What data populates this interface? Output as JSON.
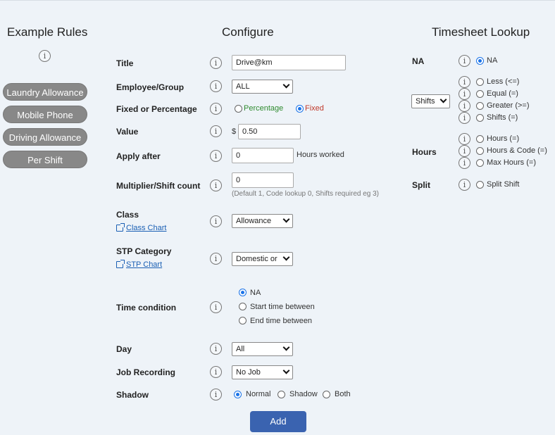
{
  "headings": {
    "example_rules": "Example Rules",
    "configure": "Configure",
    "timesheet_lookup": "Timesheet Lookup"
  },
  "example_rules": [
    "Laundry Allowance",
    "Mobile Phone",
    "Driving Allowance",
    "Per Shift"
  ],
  "info_glyph": "i",
  "form": {
    "title": {
      "label": "Title",
      "value": "Drive@km"
    },
    "employee_group": {
      "label": "Employee/Group",
      "value": "ALL"
    },
    "fixed_or_percentage": {
      "label": "Fixed or Percentage",
      "options": [
        "Percentage",
        "Fixed"
      ],
      "selected": "Fixed",
      "percentage_color": "#2e8b2e",
      "fixed_color": "#c0392b"
    },
    "value": {
      "label": "Value",
      "prefix": "$",
      "value": "0.50"
    },
    "apply_after": {
      "label": "Apply after",
      "value": "0",
      "suffix": "Hours worked"
    },
    "multiplier": {
      "label": "Multiplier/Shift count",
      "value": "0",
      "hint": "(Default 1, Code lookup 0, Shifts required eg 3)"
    },
    "class": {
      "label": "Class",
      "link": "Class Chart",
      "value": "Allowance"
    },
    "stp_category": {
      "label": "STP Category",
      "link": "STP Chart",
      "value": "Domestic or"
    },
    "time_condition": {
      "label": "Time condition",
      "options": [
        "NA",
        "Start time between",
        "End time between"
      ],
      "selected": "NA"
    },
    "day": {
      "label": "Day",
      "value": "All"
    },
    "job_recording": {
      "label": "Job Recording",
      "value": "No Job"
    },
    "shadow": {
      "label": "Shadow",
      "options": [
        "Normal",
        "Shadow",
        "Both"
      ],
      "selected": "Normal"
    },
    "add_label": "Add"
  },
  "lookup": {
    "na": {
      "label": "NA",
      "option": "NA",
      "selected": true
    },
    "shifts_select": "Shifts",
    "shift_options": [
      "Less (<=)",
      "Equal (=)",
      "Greater (>=)",
      "Shifts (=)"
    ],
    "hours": {
      "label": "Hours",
      "options": [
        "Hours (=)",
        "Hours & Code (=)",
        "Max Hours (=)"
      ]
    },
    "split": {
      "label": "Split",
      "option": "Split Shift"
    }
  },
  "colors": {
    "accent": "#3a63b0",
    "pill": "#888888",
    "background": "#eef3f8"
  }
}
